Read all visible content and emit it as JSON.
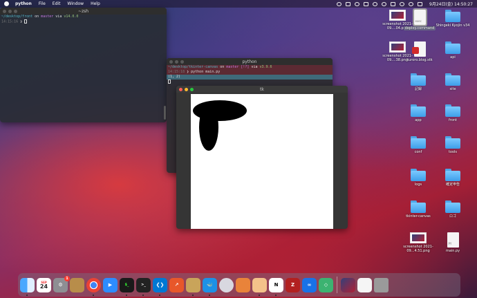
{
  "menubar": {
    "app_name": "python",
    "items": [
      "File",
      "Edit",
      "Window",
      "Help"
    ],
    "clock": "9月24日(金)  14:50:27"
  },
  "term1": {
    "title": "~zsh",
    "prompt_path": "~/desktop/front",
    "prompt_on": "on",
    "git_branch": "master",
    "via": "via",
    "node_version": "v14.0.0",
    "time": "14:15:16"
  },
  "term2": {
    "title": "python",
    "prompt_path": "~/desktop/tkinter-canvas",
    "prompt_on": "on",
    "git_branch": "master [!?]",
    "via": "via",
    "python_version": "v3.9.6",
    "time": "14:15:18",
    "command": "python main.py",
    "output": "(1, 2)"
  },
  "tk": {
    "title": "tk"
  },
  "desktop": {
    "icons": [
      {
        "label": "screenshot 2021-09....04.png",
        "kind": "shot"
      },
      {
        "label": "deploy.command",
        "kind": "doc",
        "tag": "exec"
      },
      {
        "label": "Shingeki Kyojin v34",
        "kind": "folder"
      },
      {
        "label": "screenshot 2021-09....38.png",
        "kind": "shot"
      },
      {
        "label": "kuroro.blog.stk",
        "kind": "doc"
      },
      {
        "label": "api",
        "kind": "folder"
      },
      {
        "label": "記録",
        "kind": "folder"
      },
      {
        "label": "site",
        "kind": "folder"
      },
      {
        "label": "app",
        "kind": "folder"
      },
      {
        "label": "front",
        "kind": "folder"
      },
      {
        "label": "conf",
        "kind": "folder"
      },
      {
        "label": "tools",
        "kind": "folder"
      },
      {
        "label": "logs",
        "kind": "folder"
      },
      {
        "label": "確定申告",
        "kind": "folder"
      },
      {
        "label": "tkinter-canvas",
        "kind": "folder"
      },
      {
        "label": "ロゴ",
        "kind": "folder"
      },
      {
        "label": "screenshot 2021-09...4.51.png",
        "kind": "shot"
      },
      {
        "label": "main.py",
        "kind": "doc",
        "tag": "PY"
      }
    ]
  },
  "dock": {
    "calendar_day": "24",
    "calendar_month": "SEP",
    "settings_badge": "1",
    "apps": [
      "finder",
      "calendar",
      "settings",
      "archive",
      "chrome",
      "zoom",
      "terminal-green",
      "terminal",
      "vscode",
      "instruments",
      "python-launcher",
      "docker",
      "lens",
      "sourcetree",
      "preview",
      "notion",
      "filezilla",
      "infinity",
      "kite",
      "screenshots",
      "document",
      "trash"
    ]
  },
  "colors": {
    "folder": "#4ea5e6",
    "terminal_bg": "#282c34",
    "tk_bg": "#353535"
  }
}
